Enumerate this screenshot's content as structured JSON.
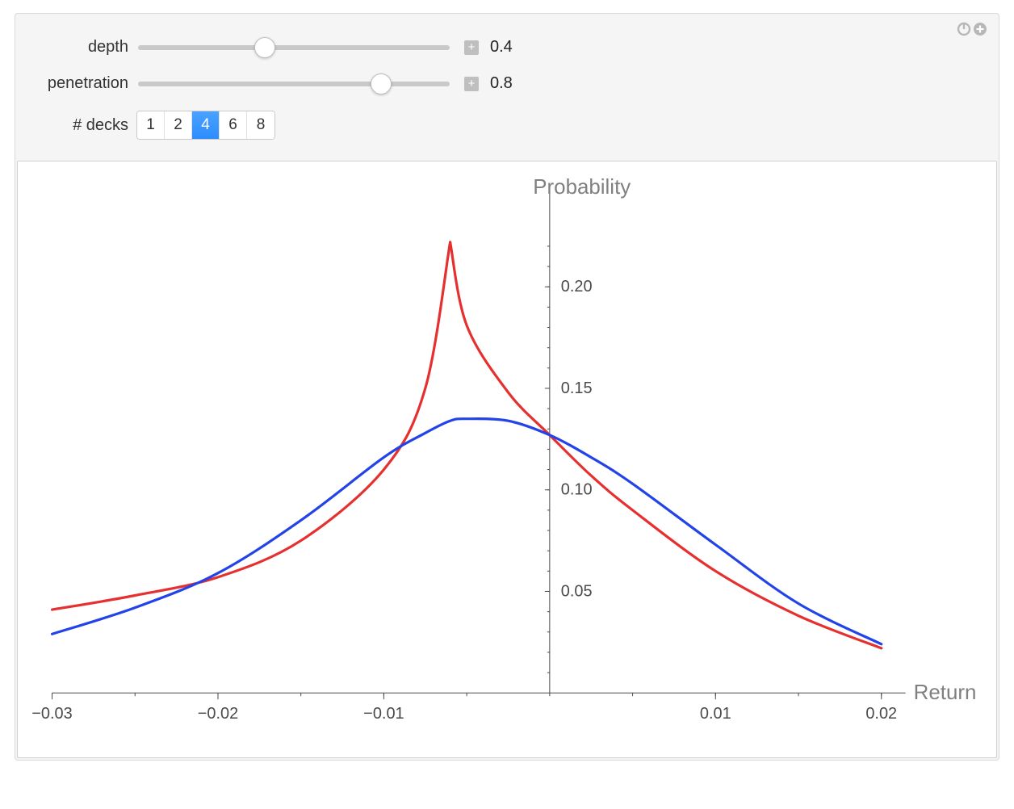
{
  "controls": {
    "depth": {
      "label": "depth",
      "value": 0.4,
      "display": "0.4",
      "min": 0,
      "max": 1
    },
    "penetration": {
      "label": "penetration",
      "value": 0.8,
      "display": "0.8",
      "min": 0,
      "max": 1
    },
    "decks": {
      "label": "# decks",
      "options": [
        "1",
        "2",
        "4",
        "6",
        "8"
      ],
      "selected": "4"
    }
  },
  "icons": {
    "plus": "+"
  },
  "chart_data": {
    "type": "line",
    "title": "Probability",
    "xlabel": "Return",
    "ylabel": "",
    "xlim": [
      -0.03,
      0.02
    ],
    "ylim": [
      0,
      0.23
    ],
    "xticks": [
      -0.03,
      -0.02,
      -0.01,
      0.01,
      0.02
    ],
    "yticks": [
      0.05,
      0.1,
      0.15,
      0.2
    ],
    "x": [
      -0.03,
      -0.025,
      -0.02,
      -0.015,
      -0.01,
      -0.0075,
      -0.006,
      -0.005,
      -0.0025,
      0.0,
      0.0025,
      0.005,
      0.01,
      0.015,
      0.02
    ],
    "series": [
      {
        "name": "red",
        "color": "#e5302f",
        "values": [
          0.041,
          0.048,
          0.057,
          0.075,
          0.11,
          0.15,
          0.222,
          0.181,
          0.148,
          0.127,
          0.107,
          0.09,
          0.06,
          0.038,
          0.022
        ]
      },
      {
        "name": "blue",
        "color": "#2243e8",
        "values": [
          0.029,
          0.042,
          0.059,
          0.085,
          0.116,
          0.128,
          0.134,
          0.135,
          0.134,
          0.127,
          0.116,
          0.103,
          0.073,
          0.044,
          0.024
        ]
      }
    ]
  }
}
